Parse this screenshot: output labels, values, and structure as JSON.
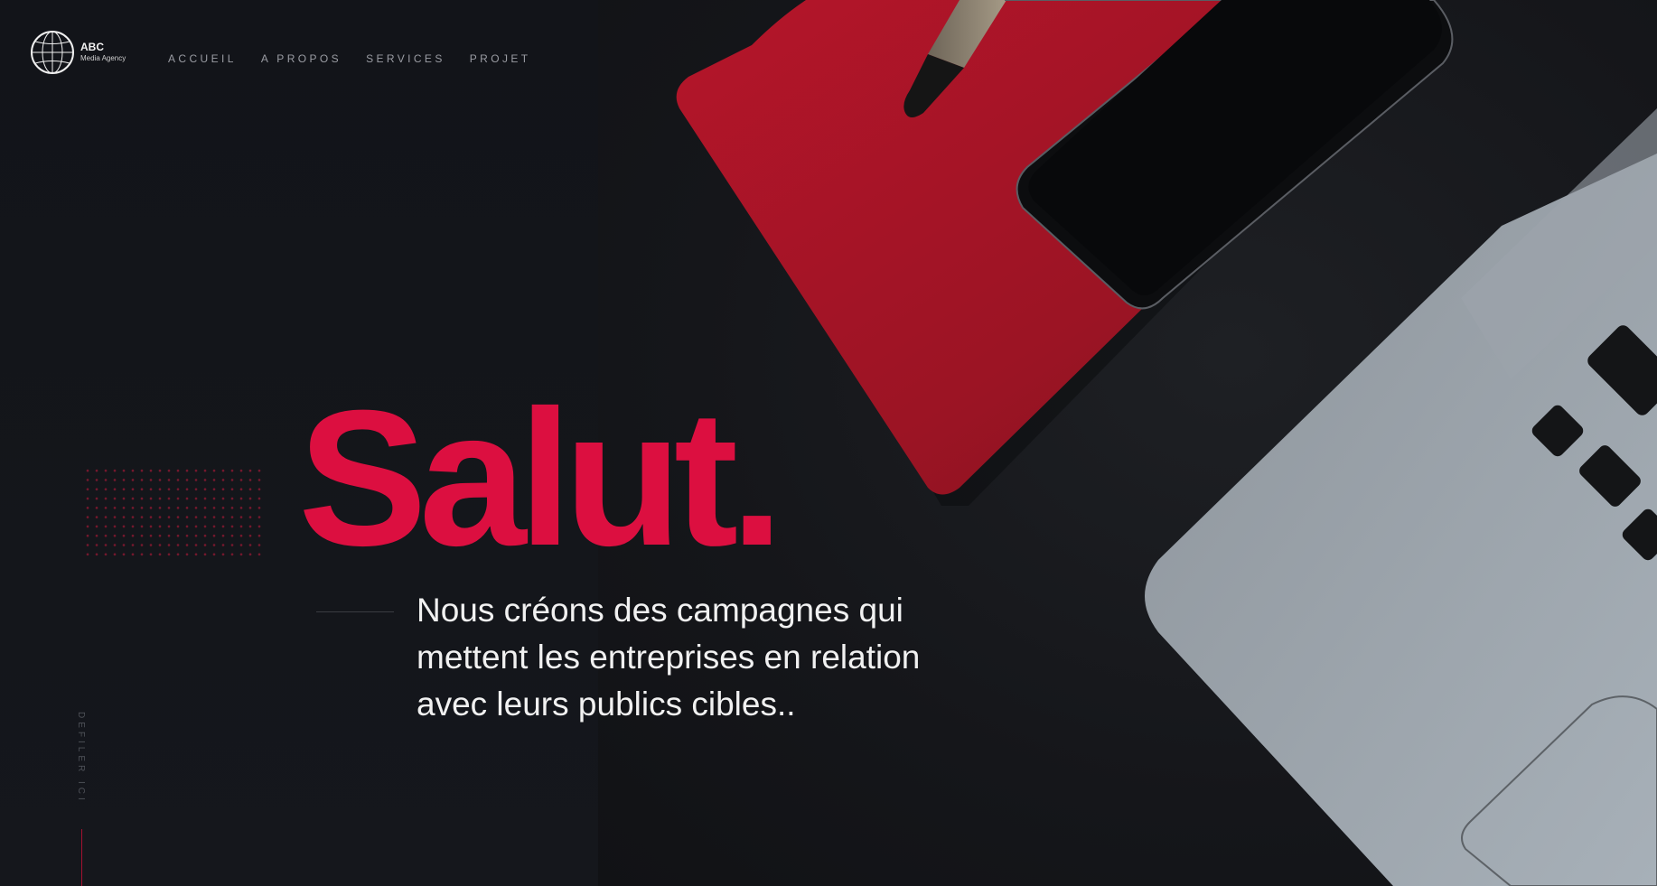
{
  "header": {
    "logo_brand": "ABC",
    "logo_sub": "Media Agency",
    "nav": [
      {
        "label": "ACCUEIL"
      },
      {
        "label": "A PROPOS"
      },
      {
        "label": "SERVICES"
      },
      {
        "label": "PROJET"
      }
    ]
  },
  "hero": {
    "title": "Salut.",
    "subtitle": "Nous créons des campagnes qui mettent les entreprises en relation avec leurs publics cibles.."
  },
  "scroll_cue": "DEFILER ICI",
  "colors": {
    "accent": "#dc0f40",
    "background": "#121418",
    "text": "#f1f1f1",
    "nav_text": "#9a9ca3"
  },
  "icons": [
    "globe-icon"
  ]
}
